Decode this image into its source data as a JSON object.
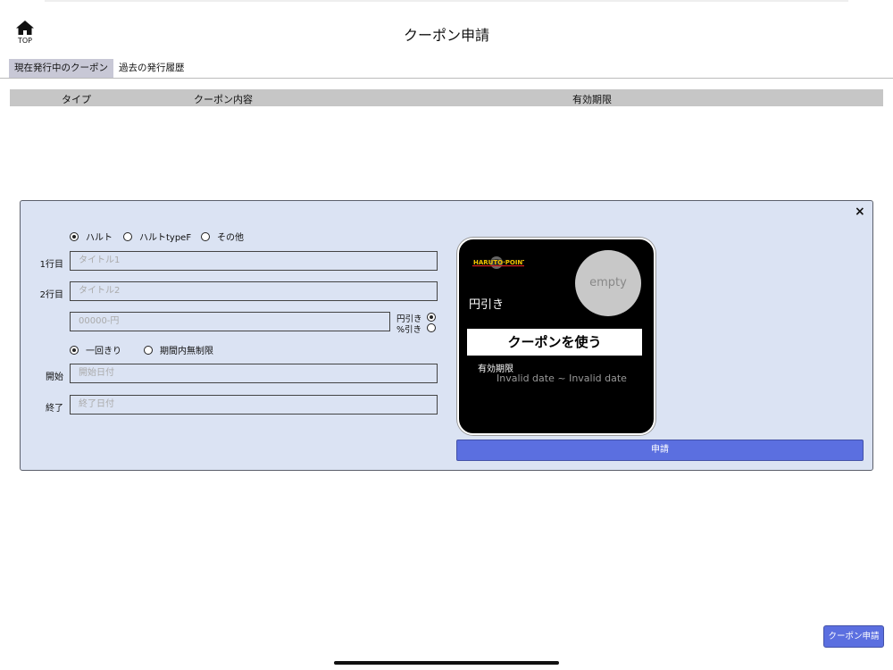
{
  "header": {
    "home_label": "TOP",
    "title": "クーポン申請"
  },
  "tabs": [
    {
      "label": "現在発行中のクーポン",
      "active": true
    },
    {
      "label": "過去の発行履歴",
      "active": false
    }
  ],
  "table": {
    "columns": [
      "タイプ",
      "クーポン内容",
      "有効期限"
    ]
  },
  "modal": {
    "close_label": "×",
    "type_options": [
      {
        "label": "ハルト",
        "selected": true
      },
      {
        "label": "ハルトtypeF",
        "selected": false
      },
      {
        "label": "その他",
        "selected": false
      }
    ],
    "line1": {
      "label": "1行目",
      "placeholder": "タイトル1"
    },
    "line2": {
      "label": "2行目",
      "placeholder": "タイトル2"
    },
    "amount": {
      "placeholder": "00000-円"
    },
    "discount_units": [
      {
        "label": "円引き",
        "selected": true
      },
      {
        "label": "%引き",
        "selected": false
      }
    ],
    "usage_options": [
      {
        "label": "一回きり",
        "selected": true
      },
      {
        "label": "期間内無制限",
        "selected": false
      }
    ],
    "start": {
      "label": "開始",
      "placeholder": "開始日付"
    },
    "end": {
      "label": "終了",
      "placeholder": "終了日付"
    },
    "preview": {
      "logo_text": "HARUTO·POINTING",
      "image_placeholder": "empty",
      "discount_type": "円引き",
      "use_button": "クーポンを使う",
      "expiry_label": "有効期限",
      "expiry_value": "Invalid date ~ Invalid date"
    },
    "submit_label": "申請"
  },
  "footer": {
    "apply_button": "クーポン申請"
  },
  "colors": {
    "accent": "#5b6fe0",
    "modal_bg": "#dbe3f3",
    "tab_active_bg": "#c8c8d6",
    "table_header_bg": "#c6c6c6"
  }
}
